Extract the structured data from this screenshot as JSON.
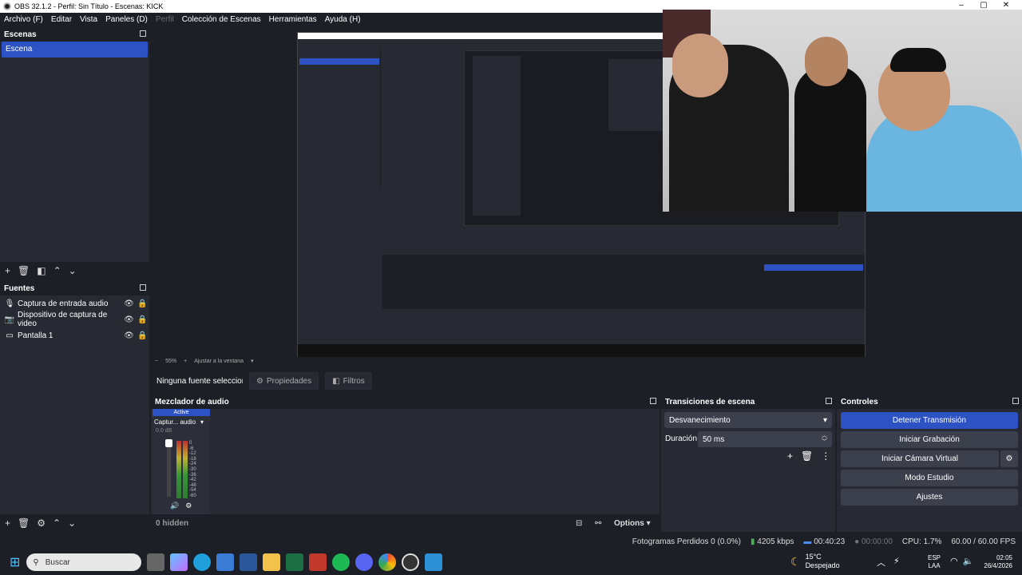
{
  "window": {
    "title": "OBS 32.1.2 - Perfil: Sin Título - Escenas: KICK"
  },
  "menu": [
    "Archivo (F)",
    "Editar",
    "Vista",
    "Paneles (D)",
    "Perfil",
    "Colección de Escenas",
    "Herramientas",
    "Ayuda (H)"
  ],
  "scenes": {
    "title": "Escenas",
    "items": [
      "Escena"
    ]
  },
  "sources": {
    "title": "Fuentes",
    "items": [
      {
        "label": "Captura de entrada audio",
        "icon": "mic-icon"
      },
      {
        "label": "Dispositivo de captura de video",
        "icon": "camera-icon"
      },
      {
        "label": "Pantalla 1",
        "icon": "monitor-icon"
      }
    ]
  },
  "context": {
    "selected": "Ninguna fuente seleccionada",
    "properties": "Propiedades",
    "filters": "Filtros"
  },
  "mixer": {
    "title": "Mezclador de audio",
    "active": "Active",
    "channel": "Captur... audio",
    "db": "0.0 dB",
    "scale": [
      "0",
      "-6",
      "-12",
      "-18",
      "-24",
      "-30",
      "-36",
      "-42",
      "-48",
      "-54",
      "-60"
    ],
    "hidden": "0 hidden",
    "options": "Options"
  },
  "transitions": {
    "title": "Transiciones de escena",
    "type": "Desvanecimiento",
    "duration_label": "Duración",
    "duration": "50 ms"
  },
  "controls": {
    "title": "Controles",
    "buttons": [
      "Detener Transmisión",
      "Iniciar Grabación",
      "Iniciar Cámara Virtual",
      "Modo Estudio",
      "Ajustes"
    ]
  },
  "preview": {
    "zoom": "55%",
    "fit": "Ajustar a la ventana"
  },
  "status": {
    "dropped": "Fotogramas Perdidos 0 (0.0%)",
    "bitrate": "4205 kbps",
    "stream_time": "00:40:23",
    "rec_time": "00:00:00",
    "cpu": "CPU: 1.7%",
    "fps": "60.00 / 60.00 FPS"
  },
  "taskbar": {
    "search": "Buscar",
    "temp": "15°C",
    "weather": "Despejado",
    "lang1": "ESP",
    "lang2": "LAA",
    "time": "02:05",
    "date": "26/4/2026"
  },
  "colors": {
    "accent": "#2c52c4",
    "panel": "#272a33",
    "bg": "#1d1f26",
    "button": "#3c404d"
  }
}
